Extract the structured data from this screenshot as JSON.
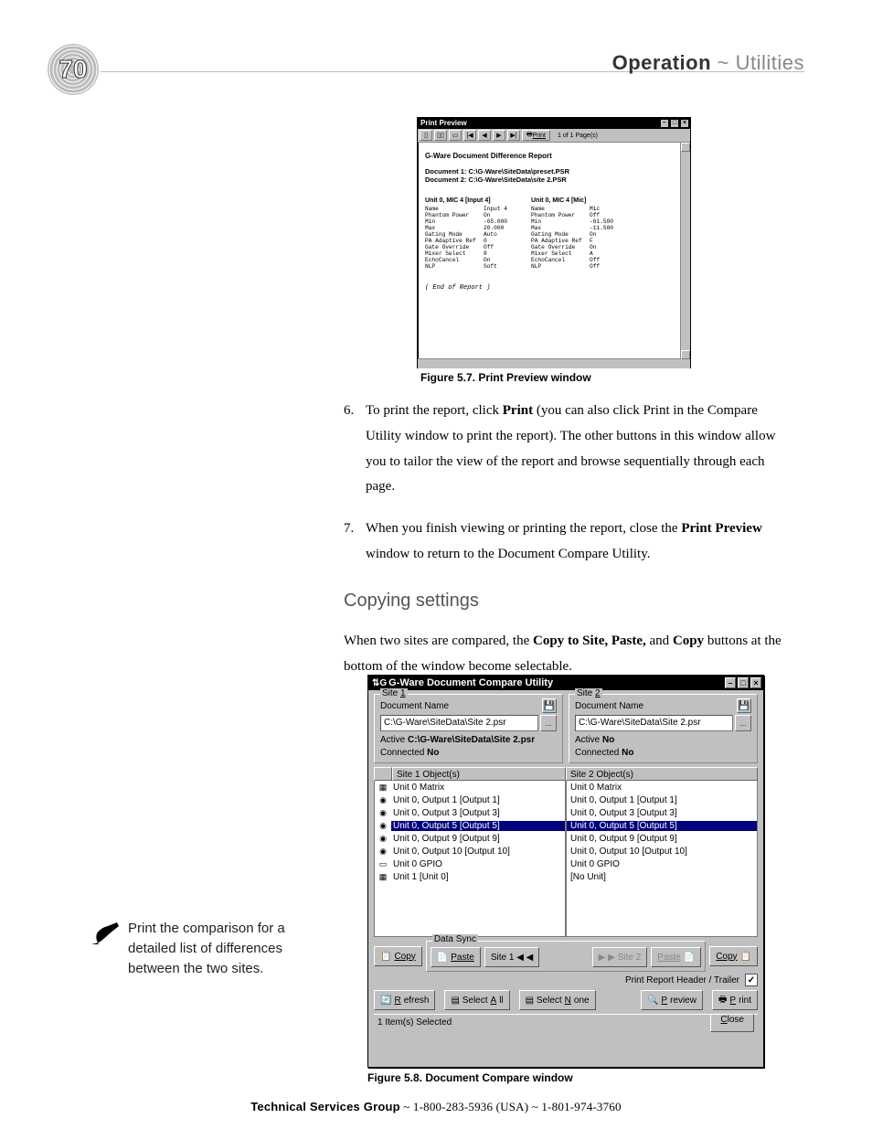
{
  "page_number": "70",
  "header": {
    "breadcrumb_bold": "Operation",
    "sep": " ~ ",
    "breadcrumb_light": "Utilities"
  },
  "print_preview": {
    "title": "Print Preview",
    "toolbar": {
      "pages_label": "1 of 1 Page(s)",
      "print_btn": "Print"
    },
    "report_title": "G-Ware Document Difference Report",
    "doc1": "Document 1: C:\\G-Ware\\SiteData\\preset.PSR",
    "doc2": "Document 2: C:\\G-Ware\\SiteData\\site 2.PSR",
    "col_left": {
      "heading": "Unit 0, MIC 4 [Input 4]",
      "rows": [
        {
          "k": "Name",
          "v": "Input 4"
        },
        {
          "k": "Phantom Power",
          "v": "On"
        },
        {
          "k": "Min",
          "v": "-65.000"
        },
        {
          "k": "Max",
          "v": "20.000"
        },
        {
          "k": "Gating Mode",
          "v": "Auto"
        },
        {
          "k": "PA Adaptive Ref",
          "v": "0"
        },
        {
          "k": "Gate Override",
          "v": "Off"
        },
        {
          "k": "Mixer Select",
          "v": "8"
        },
        {
          "k": "EchoCancel",
          "v": "On"
        },
        {
          "k": "NLP",
          "v": "Soft"
        }
      ]
    },
    "col_right": {
      "heading": "Unit 0, MIC 4 [Mic]",
      "rows": [
        {
          "k": "Name",
          "v": "Mic"
        },
        {
          "k": "Phantom Power",
          "v": "Off"
        },
        {
          "k": "Min",
          "v": "-61.500"
        },
        {
          "k": "Max",
          "v": "-11.500"
        },
        {
          "k": "Gating Mode",
          "v": "On"
        },
        {
          "k": "PA Adaptive Ref",
          "v": "F"
        },
        {
          "k": "Gate Override",
          "v": "On"
        },
        {
          "k": "Mixer Select",
          "v": "A"
        },
        {
          "k": "EchoCancel",
          "v": "Off"
        },
        {
          "k": "NLP",
          "v": "Off"
        }
      ]
    },
    "end": "( End of Report )",
    "caption": "Figure 5.7. Print Preview window"
  },
  "steps": {
    "s6_num": "6.",
    "s6_a": "To print the report, click ",
    "s6_b": "Print",
    "s6_c": " (you can also click Print in the Compare Utility window to print the report). The other buttons in this window allow you to tailor the view of the report and browse sequentially through each page.",
    "s7_num": "7.",
    "s7_a": "When you finish viewing or printing the report, close the ",
    "s7_b": "Print Preview",
    "s7_c": " window to return to the Document Compare Utility."
  },
  "subheading": "Copying settings",
  "intro_a": "When two sites are compared, the ",
  "intro_b": "Copy to Site, Paste,",
  "intro_c": " and ",
  "intro_d": "Copy",
  "intro_e": " buttons at the bottom of the window become selectable.",
  "callout": "Print the comparison for a detailed list of differences between the two sites.",
  "compare": {
    "title": "G-Ware Document Compare Utility",
    "site1": {
      "legend_pre": "Site ",
      "legend_u": "1",
      "doc_label": "Document Name",
      "path": "C:\\G-Ware\\SiteData\\Site 2.psr",
      "active_label": "Active  ",
      "active_value": "C:\\G-Ware\\SiteData\\Site 2.psr",
      "connected_label": "Connected  ",
      "connected_value": "No"
    },
    "site2": {
      "legend_pre": "Site ",
      "legend_u": "2",
      "doc_label": "Document Name",
      "path": "C:\\G-Ware\\SiteData\\Site 2.psr",
      "active_label": "Active  ",
      "active_value": "No",
      "connected_label": "Connected  ",
      "connected_value": "No"
    },
    "headers": {
      "icon": "",
      "site1": "Site 1 Object(s)",
      "site2": "Site 2 Object(s)"
    },
    "left_rows": [
      {
        "icon": "▦",
        "t": "Unit 0 Matrix"
      },
      {
        "icon": "◉",
        "t": "Unit 0, Output 1 [Output 1]"
      },
      {
        "icon": "◉",
        "t": "Unit 0, Output 3 [Output 3]"
      },
      {
        "icon": "◉",
        "t": "Unit 0, Output 5 [Output 5]",
        "sel": true
      },
      {
        "icon": "◉",
        "t": "Unit 0, Output 9 [Output 9]"
      },
      {
        "icon": "◉",
        "t": "Unit 0, Output 10 [Output 10]"
      },
      {
        "icon": "▭",
        "t": "Unit 0 GPIO"
      },
      {
        "icon": "▦",
        "t": "Unit 1 [Unit 0]"
      }
    ],
    "right_rows": [
      {
        "t": "Unit 0 Matrix"
      },
      {
        "t": "Unit 0, Output 1 [Output 1]"
      },
      {
        "t": "Unit 0, Output 3 [Output 3]"
      },
      {
        "t": "Unit 0, Output 5 [Output 5]",
        "sel": true
      },
      {
        "t": "Unit 0, Output 9 [Output 9]"
      },
      {
        "t": "Unit 0, Output 10 [Output 10]"
      },
      {
        "t": "Unit 0 GPIO"
      },
      {
        "t": "[No Unit]"
      }
    ],
    "sync_legend": "Data Sync",
    "buttons": {
      "copy_l": "Copy",
      "paste_l": "Paste",
      "site1_btn": "Site 1 ◀ ◀",
      "site2_btn": "▶  ▶  Site 2",
      "paste_r": "Paste",
      "copy_r": "Copy"
    },
    "chk_label": "Print Report Header / Trailer",
    "actions": {
      "refresh": "Refresh",
      "select_all": "Select All",
      "select_none": "Select None",
      "preview": "Preview",
      "print": "Print"
    },
    "status": "1 Item(s) Selected",
    "close": "Close",
    "caption": "Figure 5.8. Document Compare window"
  },
  "footer": {
    "a": "Technical Services Group",
    "b": " ~ 1-800-283-5936 (USA) ~ 1-801-974-3760"
  }
}
